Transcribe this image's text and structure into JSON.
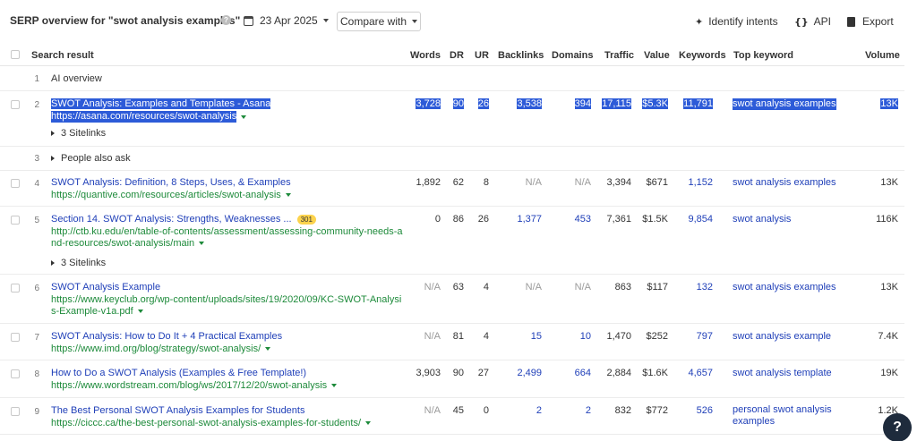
{
  "toolbar": {
    "title": "SERP overview for \"swot analysis examples\"",
    "help_icon": "?",
    "date": "23 Apr 2025",
    "compare_label": "Compare with",
    "identify_label": "Identify intents",
    "api_label": "API",
    "api_icon": "{}",
    "export_label": "Export"
  },
  "columns": {
    "result": "Search result",
    "words": "Words",
    "dr": "DR",
    "ur": "UR",
    "backlinks": "Backlinks",
    "domains": "Domains",
    "traffic": "Traffic",
    "value": "Value",
    "keywords": "Keywords",
    "top_keyword": "Top keyword",
    "volume": "Volume"
  },
  "rows": [
    {
      "pos": "1",
      "label": "AI overview"
    },
    {
      "pos": "2",
      "title": "SWOT Analysis: Examples and Templates - Asana",
      "url": "https://asana.com/resources/swot-analysis",
      "sitelinks": "3 Sitelinks",
      "words": "3,728",
      "dr": "90",
      "ur": "26",
      "backlinks": "3,538",
      "domains": "394",
      "traffic": "17,115",
      "value": "$5.3K",
      "keywords": "11,791",
      "top_keyword": "swot analysis examples",
      "volume": "13K"
    },
    {
      "pos": "3",
      "label": "People also ask"
    },
    {
      "pos": "4",
      "title": "SWOT Analysis: Definition, 8 Steps, Uses, & Examples",
      "url": "https://quantive.com/resources/articles/swot-analysis",
      "words": "1,892",
      "dr": "62",
      "ur": "8",
      "backlinks": "N/A",
      "domains": "N/A",
      "traffic": "3,394",
      "value": "$671",
      "keywords": "1,152",
      "top_keyword": "swot analysis examples",
      "volume": "13K"
    },
    {
      "pos": "5",
      "title": "Section 14. SWOT Analysis: Strengths, Weaknesses ...",
      "badge": "301",
      "url_line1": "http://ctb.ku.edu/en/table-of-contents/assessment/assessing-community-needs-a",
      "url_line2": "nd-resources/swot-analysis/main",
      "sitelinks": "3 Sitelinks",
      "words": "0",
      "dr": "86",
      "ur": "26",
      "backlinks": "1,377",
      "domains": "453",
      "traffic": "7,361",
      "value": "$1.5K",
      "keywords": "9,854",
      "top_keyword": "swot analysis",
      "volume": "116K"
    },
    {
      "pos": "6",
      "title": "SWOT Analysis Example",
      "url_line1": "https://www.keyclub.org/wp-content/uploads/sites/19/2020/09/KC-SWOT-Analysi",
      "url_line2": "s-Example-v1a.pdf",
      "words": "N/A",
      "dr": "63",
      "ur": "4",
      "backlinks": "N/A",
      "domains": "N/A",
      "traffic": "863",
      "value": "$117",
      "keywords": "132",
      "top_keyword": "swot analysis examples",
      "volume": "13K"
    },
    {
      "pos": "7",
      "title": "SWOT Analysis: How to Do It + 4 Practical Examples",
      "url": "https://www.imd.org/blog/strategy/swot-analysis/",
      "words": "N/A",
      "dr": "81",
      "ur": "4",
      "backlinks": "15",
      "domains": "10",
      "traffic": "1,470",
      "value": "$252",
      "keywords": "797",
      "top_keyword": "swot analysis example",
      "volume": "7.4K"
    },
    {
      "pos": "8",
      "title": "How to Do a SWOT Analysis (Examples & Free Template!)",
      "url": "https://www.wordstream.com/blog/ws/2017/12/20/swot-analysis",
      "words": "3,903",
      "dr": "90",
      "ur": "27",
      "backlinks": "2,499",
      "domains": "664",
      "traffic": "2,884",
      "value": "$1.6K",
      "keywords": "4,657",
      "top_keyword": "swot analysis template",
      "volume": "19K"
    },
    {
      "pos": "9",
      "title": "The Best Personal SWOT Analysis Examples for Students",
      "url": "https://ciccc.ca/the-best-personal-swot-analysis-examples-for-students/",
      "words": "N/A",
      "dr": "45",
      "ur": "0",
      "backlinks": "2",
      "domains": "2",
      "traffic": "832",
      "value": "$772",
      "keywords": "526",
      "top_keyword_line1": "personal swot analysis",
      "top_keyword_line2": "examples",
      "volume": "1.2K"
    }
  ],
  "help_bubble": "?"
}
